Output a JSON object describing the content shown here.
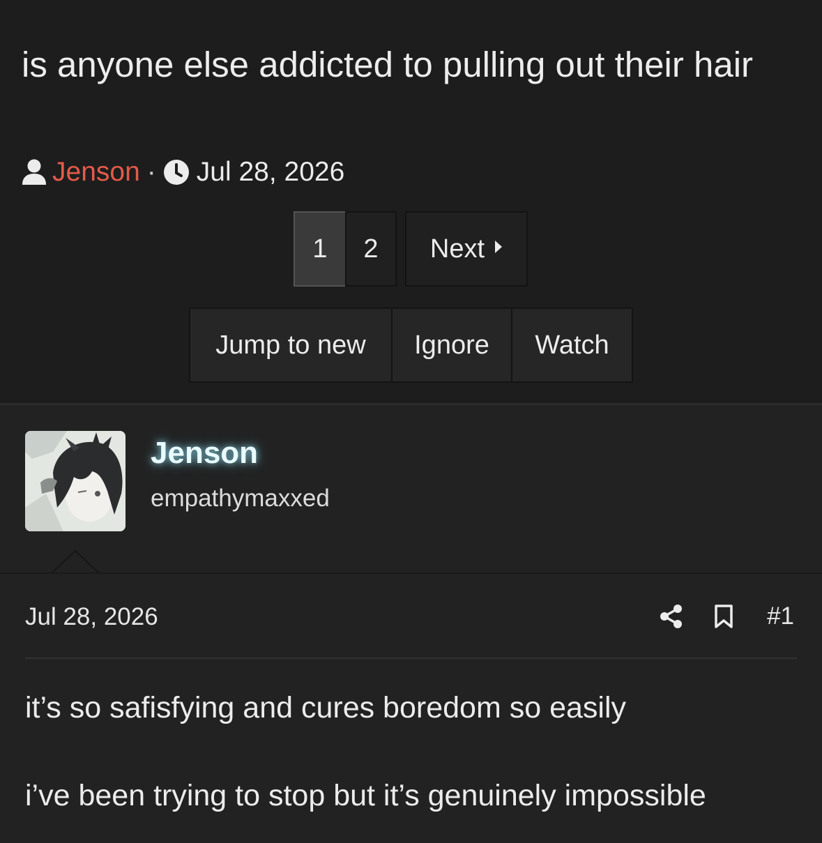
{
  "thread": {
    "title": "is anyone else addicted to pulling out their hair",
    "author": "Jenson",
    "separator": "·",
    "date": "Jul 28, 2026",
    "author_icon": "user-icon",
    "date_icon": "clock-icon"
  },
  "pagination": {
    "pages": [
      "1",
      "2"
    ],
    "current_page": "1",
    "next_label": "Next",
    "next_icon": "caret-right-icon"
  },
  "actions": {
    "jump_to_new": "Jump to new",
    "ignore": "Ignore",
    "watch": "Watch"
  },
  "post": {
    "username": "Jenson",
    "user_title": "empathymaxxed",
    "date": "Jul 28, 2026",
    "number": "#1",
    "share_icon": "share-icon",
    "bookmark_icon": "bookmark-icon",
    "lines": [
      "it’s so safisfying and cures boredom so easily",
      "i’ve been trying to stop but it’s genuinely impossible"
    ]
  },
  "colors": {
    "background": "#202020",
    "author_link": "#e45a4a",
    "username_glow": "#a0f0ff",
    "text": "#ececec"
  }
}
